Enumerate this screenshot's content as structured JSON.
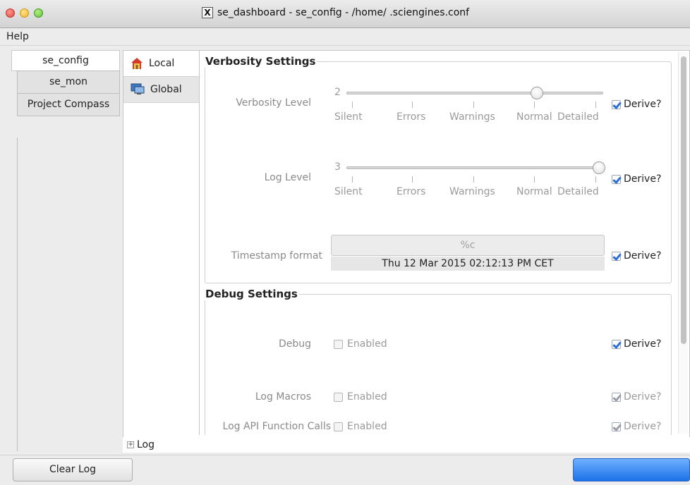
{
  "window": {
    "title": "se_dashboard - se_config - /home/    .sciengines.conf"
  },
  "menu": {
    "help": "Help"
  },
  "left_tabs": [
    {
      "label": "se_config"
    },
    {
      "label": "se_mon"
    },
    {
      "label": "Project Compass"
    }
  ],
  "sub_tabs": [
    {
      "label": "Local",
      "icon": "house-icon"
    },
    {
      "label": "Global",
      "icon": "monitor-icon"
    }
  ],
  "verbosity": {
    "title": "Verbosity Settings",
    "verbosity_level": {
      "label": "Verbosity Level",
      "value": "2",
      "slider_fraction": 0.75
    },
    "log_level": {
      "label": "Log Level",
      "value": "3",
      "slider_fraction": 1.0
    },
    "ticks": [
      "Silent",
      "Errors",
      "Warnings",
      "Normal",
      "Detailed"
    ],
    "timestamp": {
      "label": "Timestamp format",
      "placeholder": "%c",
      "preview": "Thu 12 Mar 2015 02:12:13 PM CET"
    },
    "derive_label": "Derive?"
  },
  "debug": {
    "title": "Debug Settings",
    "rows": [
      {
        "label": "Debug",
        "enabled": "Enabled",
        "derive": "Derive?"
      },
      {
        "label": "Log Macros",
        "enabled": "Enabled",
        "derive": "Derive?"
      },
      {
        "label": "Log API Function Calls",
        "enabled": "Enabled",
        "derive": "Derive?"
      }
    ]
  },
  "log_toggle": "Log",
  "buttons": {
    "clear_log": "Clear Log"
  },
  "colors": {
    "accent": "#1c71e8",
    "check": "#2e6fd6"
  }
}
